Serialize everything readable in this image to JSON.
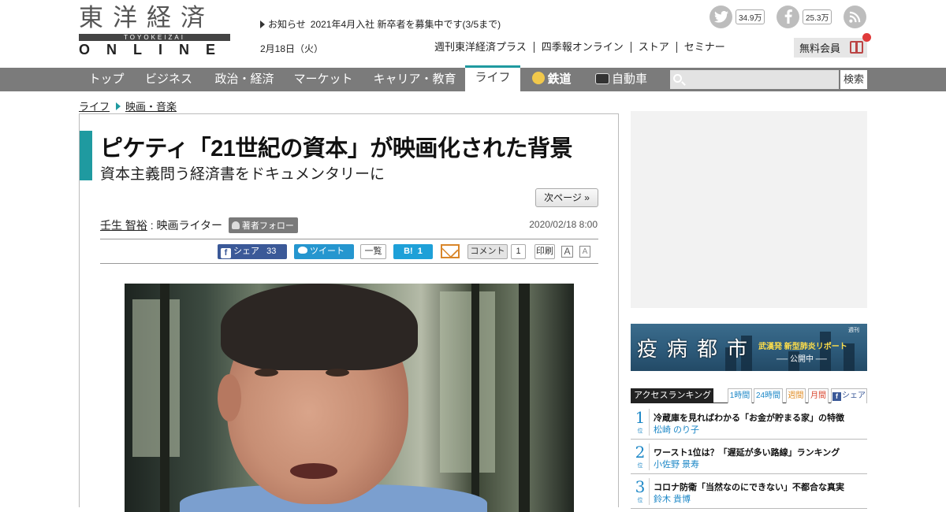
{
  "logo": {
    "kanji": "東洋経済",
    "roman": "TOYOKEIZAI",
    "online": "ONLINE"
  },
  "notice": {
    "label": "お知らせ",
    "text": "2021年4月入社 新卒者を募集中です(3/5まで)"
  },
  "date": "2月18日（火）",
  "top_links": [
    "週刊東洋経済プラス",
    "四季報オンライン",
    "ストア",
    "セミナー"
  ],
  "social": {
    "twitter_count": "34.9万",
    "facebook_count": "25.3万"
  },
  "member_button": "無料会員",
  "nav": {
    "items": [
      "トップ",
      "ビジネス",
      "政治・経済",
      "マーケット",
      "キャリア・教育",
      "ライフ",
      "鉄道",
      "自動車"
    ],
    "active": "ライフ",
    "search_button": "検索",
    "search_placeholder": ""
  },
  "breadcrumb": [
    "ライフ",
    "映画・音楽"
  ],
  "article": {
    "title": "ピケティ「21世紀の資本」が映画化された背景",
    "subtitle": "資本主義問う経済書をドキュメンタリーに",
    "next_page": "次ページ »",
    "author": "壬生 智裕",
    "author_role": ": 映画ライター",
    "follow": "著者フォロー",
    "published": "2020/02/18 8:00"
  },
  "share": {
    "fb_label": "シェア",
    "fb_count": "33",
    "fb_icon": "f",
    "tweet_label": "ツイート",
    "list_label": "一覧",
    "hatena_label": "B!",
    "hatena_count": "1",
    "comment_label": "コメント",
    "comment_count": "1",
    "print_label": "印刷",
    "font_up": "A",
    "font_down": "A"
  },
  "sidebar": {
    "banner": {
      "publisher": "週刊",
      "title": "疫病都市",
      "tagline": "武漢発 新型肺炎リポート",
      "status": "── 公開中 ──"
    },
    "ranking": {
      "title": "アクセスランキング",
      "tabs": [
        "1時間",
        "24時間",
        "週間",
        "月間",
        "シェア"
      ],
      "rank_suffix": "位",
      "items": [
        {
          "rank": "1",
          "headline": "冷蔵庫を見ればわかる「お金が貯まる家」の特徴",
          "author": "松崎 のり子"
        },
        {
          "rank": "2",
          "headline": "ワースト1位は？「遅延が多い路線」ランキング",
          "author": "小佐野 景寿"
        },
        {
          "rank": "3",
          "headline": "コロナ防衛「当然なのにできない」不都合な真実",
          "author": "鈴木 貴博"
        }
      ]
    }
  },
  "colors": {
    "accent": "#1f9aa0",
    "nav_bg": "#7b7b7b",
    "rank_blue": "#1e88c7",
    "fb_blue": "#3b5998",
    "twitter_blue": "#2596cf"
  }
}
